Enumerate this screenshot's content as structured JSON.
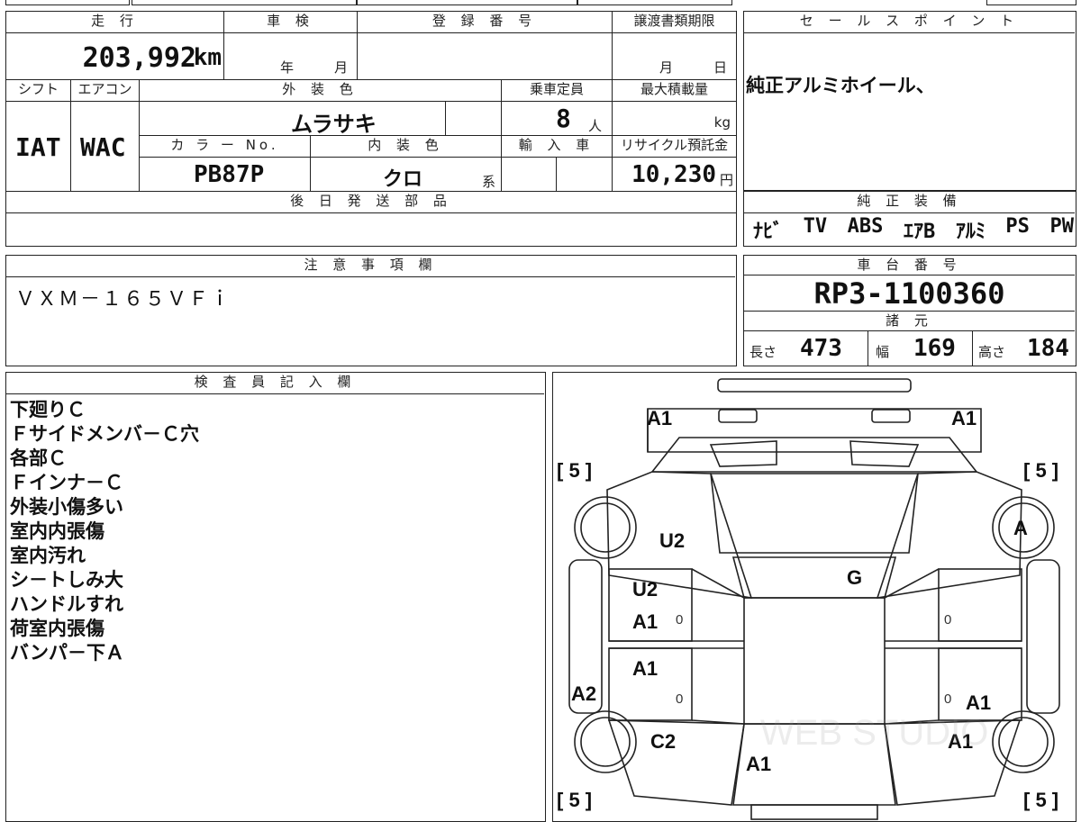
{
  "header": {
    "mileage_label": "走 行",
    "inspection_label": "車 検",
    "registration_label": "登 録 番 号",
    "transfer_deadline_label": "譲渡書類期限",
    "mileage_value": "203,992",
    "mileage_unit": "km",
    "inspection_year": "年",
    "inspection_month": "月",
    "transfer_month": "月",
    "transfer_day": "日"
  },
  "specs": {
    "shift_label": "シフト",
    "aircon_label": "エアコン",
    "exterior_color_label": "外 装 色",
    "capacity_label": "乗車定員",
    "max_load_label": "最大積載量",
    "shift_value": "IAT",
    "aircon_value": "WAC",
    "exterior_color_value": "ムラサキ",
    "capacity_value": "8",
    "capacity_unit": "人",
    "max_load_unit": "kg",
    "color_no_label": "カ ラ ー No.",
    "interior_color_label": "内 装 色",
    "import_label": "輸 入 車",
    "recycle_label": "リサイクル預託金",
    "color_no_value": "PB87P",
    "interior_color_value": "クロ",
    "interior_suffix": "系",
    "recycle_value": "10,230",
    "recycle_unit": "円",
    "later_parts_label": "後 日 発 送 部 品"
  },
  "sales_point": {
    "label": "セ ー ル ス ポ イ ン ト",
    "text": "純正アルミホイール、"
  },
  "equipment": {
    "label": "純 正 装 備",
    "items": [
      "ﾅﾋﾞ",
      "TV",
      "ABS",
      "ｴｱB",
      "ｱﾙﾐ",
      "PS",
      "PW"
    ]
  },
  "notes": {
    "label": "注 意 事 項 欄",
    "text": "ＶＸＭ－１６５ＶＦｉ"
  },
  "chassis": {
    "label": "車 台 番 号",
    "value": "RP3-1100360",
    "dims_label": "諸 元",
    "length_label": "長さ",
    "length_value": "473",
    "width_label": "幅",
    "width_value": "169",
    "height_label": "高さ",
    "height_value": "184"
  },
  "inspector": {
    "label": "検 査 員 記 入 欄",
    "lines": [
      "下廻りＣ",
      "Ｆサイドメンバ－Ｃ穴",
      "各部Ｃ",
      "Ｆインナ－Ｃ",
      "外装小傷多い",
      "室内内張傷",
      "室内汚れ",
      "シ－トしみ大",
      "ハンドルすれ",
      "荷室内張傷",
      "バンパ－下Ａ"
    ]
  },
  "diagram": {
    "marks": {
      "front_left": "A1",
      "front_right": "A1",
      "tire_fl": "[ 5 ]",
      "tire_fr": "[ 5 ]",
      "tire_rl": "[ 5 ]",
      "tire_rr": "[ 5 ]",
      "fender_left": "U2",
      "windshield": "G",
      "right_fender_wheel": "A",
      "front_door_left_u2": "U2",
      "front_door_left_a1": "A1",
      "rear_door_left": "A1",
      "rocker_left": "A2",
      "rear_quarter_left": "C2",
      "rear_right_door": "A1",
      "rear_quarter_right": "A1",
      "rear_center": "A1",
      "zero_1": "0",
      "zero_2": "0",
      "zero_3": "0",
      "zero_4": "0"
    },
    "watermark": "WEB STUDIO"
  }
}
